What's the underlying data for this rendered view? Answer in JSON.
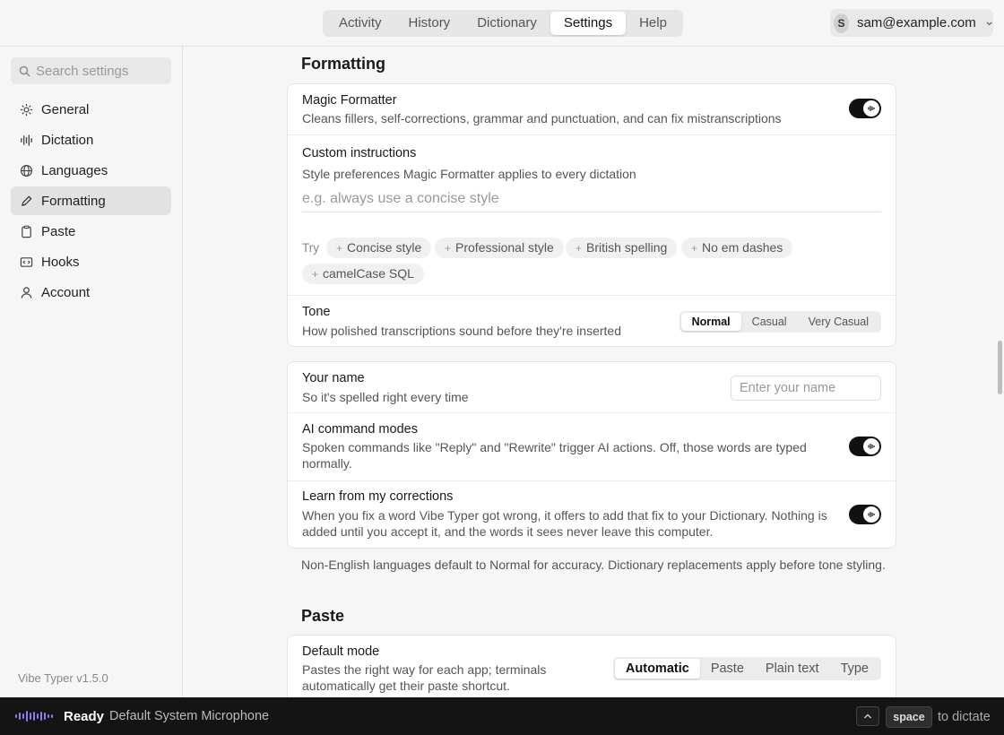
{
  "tabs": [
    "Activity",
    "History",
    "Dictionary",
    "Settings",
    "Help"
  ],
  "active_tab": "Settings",
  "account": {
    "initial": "S",
    "email": "sam@example.com"
  },
  "sidebar": {
    "search_placeholder": "Search settings",
    "items": [
      {
        "label": "General",
        "icon": "gear-icon"
      },
      {
        "label": "Dictation",
        "icon": "waveform-icon"
      },
      {
        "label": "Languages",
        "icon": "globe-icon"
      },
      {
        "label": "Formatting",
        "icon": "pen-icon"
      },
      {
        "label": "Paste",
        "icon": "clipboard-icon"
      },
      {
        "label": "Hooks",
        "icon": "code-icon"
      },
      {
        "label": "Account",
        "icon": "person-icon"
      }
    ],
    "active": "Formatting",
    "version": "Vibe Typer v1.5.0"
  },
  "formatting": {
    "title": "Formatting",
    "magic": {
      "title": "Magic Formatter",
      "desc": "Cleans fillers, self-corrections, grammar and punctuation, and can fix mistranscriptions",
      "enabled": true
    },
    "custom": {
      "title": "Custom instructions",
      "desc": "Style preferences Magic Formatter applies to every dictation",
      "placeholder": "e.g. always use a concise style",
      "try_label": "Try",
      "chips": [
        "Concise style",
        "Professional style",
        "British spelling",
        "No em dashes",
        "camelCase SQL"
      ]
    },
    "tone": {
      "title": "Tone",
      "desc": "How polished transcriptions sound before they're inserted",
      "options": [
        "Normal",
        "Casual",
        "Very Casual"
      ],
      "selected": "Normal"
    },
    "name": {
      "title": "Your name",
      "desc": "So it's spelled right every time",
      "placeholder": "Enter your name"
    },
    "ai_modes": {
      "title": "AI command modes",
      "desc": "Spoken commands like \"Reply\" and \"Rewrite\" trigger AI actions. Off, those words are typed normally.",
      "enabled": true
    },
    "learn": {
      "title": "Learn from my corrections",
      "desc": "When you fix a word Vibe Typer got wrong, it offers to add that fix to your Dictionary. Nothing is added until you accept it, and the words it sees never leave this computer.",
      "enabled": true
    },
    "footnote": "Non-English languages default to Normal for accuracy. Dictionary replacements apply before tone styling."
  },
  "paste": {
    "title": "Paste",
    "default_mode": {
      "title": "Default mode",
      "desc": "Pastes the right way for each app; terminals automatically get their paste shortcut.",
      "options": [
        "Automatic",
        "Paste",
        "Plain text",
        "Type"
      ],
      "selected": "Automatic"
    }
  },
  "status": {
    "state": "Ready",
    "mic": "Default System Microphone",
    "key": "space",
    "hint": "to dictate"
  }
}
